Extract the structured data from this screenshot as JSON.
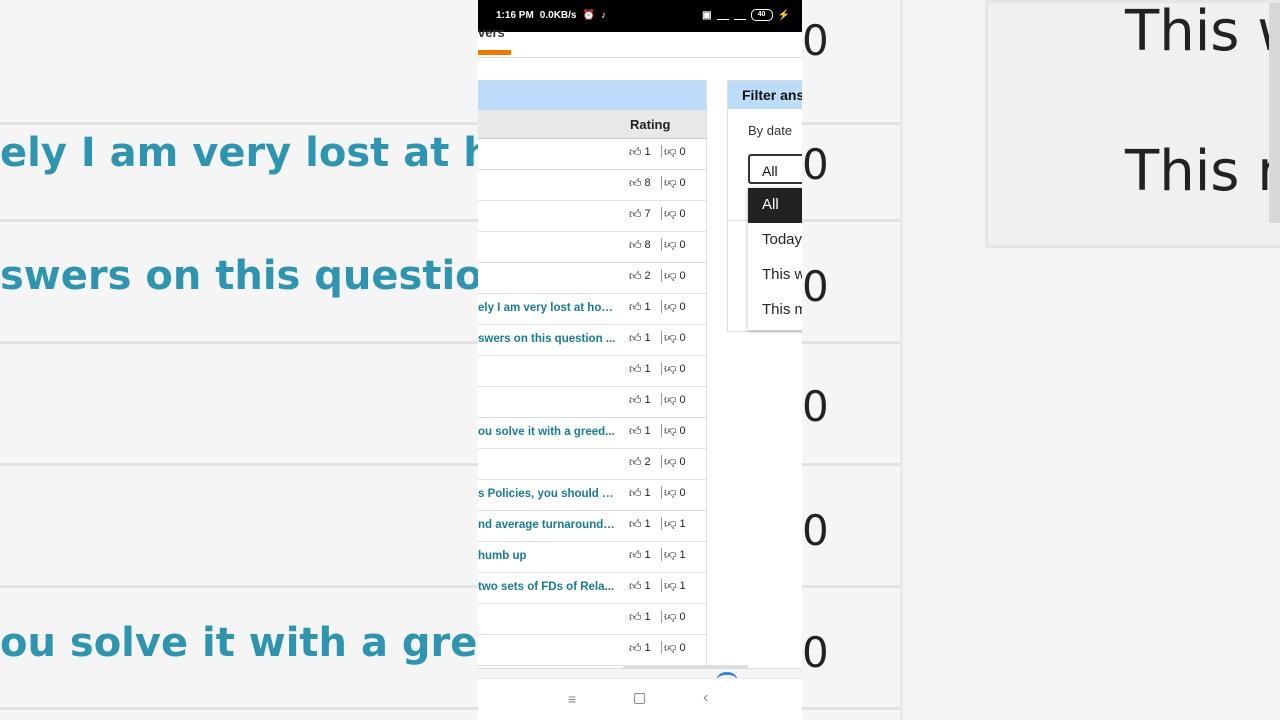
{
  "status_bar": {
    "time": "1:16 PM",
    "speed": "0.0KB/s",
    "battery": "40"
  },
  "tabs": {
    "active_label": "vers"
  },
  "table": {
    "rating_header": "Rating",
    "rows": [
      {
        "title": "",
        "up": "1",
        "down": "0"
      },
      {
        "title": "",
        "up": "8",
        "down": "0"
      },
      {
        "title": "",
        "up": "7",
        "down": "0"
      },
      {
        "title": "",
        "up": "8",
        "down": "0"
      },
      {
        "title": "",
        "up": "2",
        "down": "0"
      },
      {
        "title": "ely I am very lost at how ...",
        "up": "1",
        "down": "0"
      },
      {
        "title": "swers on this question ...",
        "up": "1",
        "down": "0"
      },
      {
        "title": "",
        "up": "1",
        "down": "0"
      },
      {
        "title": "",
        "up": "1",
        "down": "0"
      },
      {
        "title": "ou solve it with a greed...",
        "up": "1",
        "down": "0"
      },
      {
        "title": "",
        "up": "2",
        "down": "0"
      },
      {
        "title": "s Policies, you should su...",
        "up": "1",
        "down": "0"
      },
      {
        "title": "nd average turnaround t...",
        "up": "1",
        "down": "1"
      },
      {
        "title": "humb up",
        "up": "1",
        "down": "1"
      },
      {
        "title": " two sets of FDs of Rela...",
        "up": "1",
        "down": "1"
      },
      {
        "title": "",
        "up": "1",
        "down": "0"
      },
      {
        "title": "",
        "up": "1",
        "down": "0"
      }
    ]
  },
  "filter": {
    "title": "Filter ans",
    "by_date_label": "By date",
    "selected": "All",
    "options": [
      "All",
      "Today",
      "This w",
      "This m"
    ]
  },
  "background": {
    "row_texts": [
      "ely I am very lost at how",
      "swers on this question",
      "",
      "ou solve it with a greed"
    ],
    "zero": "0",
    "right_texts": [
      "This w",
      "This m"
    ]
  },
  "nav": {
    "menu_glyph": "≡",
    "back_glyph": "‹"
  },
  "icons": {
    "thumb_up": "thumbs-up-icon",
    "thumb_down": "thumbs-down-icon"
  },
  "colors": {
    "link": "#1a7a90",
    "header_blue": "#bcdcfa",
    "tab_accent": "#f07800"
  }
}
